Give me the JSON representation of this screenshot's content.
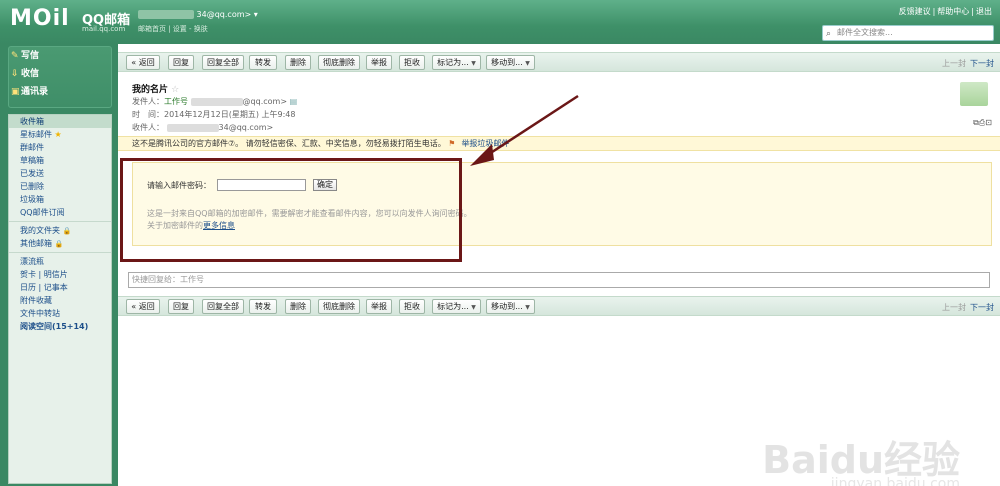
{
  "header": {
    "logo_text": "MOil",
    "brand": "QQ邮箱",
    "brand_url": "mail.qq.com",
    "user_email": "34@qq.com>",
    "user_links": "邮箱首页 | 设置 - 换肤",
    "top_links": [
      "反馈建议",
      "帮助中心",
      "退出"
    ],
    "search_placeholder": "邮件全文搜索..."
  },
  "sidebar": {
    "quick": [
      {
        "label": "写信",
        "icon": "pen-icon"
      },
      {
        "label": "收信",
        "icon": "inbox-icon"
      },
      {
        "label": "通讯录",
        "icon": "contacts-icon"
      }
    ],
    "folders": [
      "收件箱",
      "星标邮件",
      "群邮件",
      "草稿箱",
      "已发送",
      "已删除",
      "垃圾箱",
      "QQ邮件订阅"
    ],
    "folders2": [
      "我的文件夹",
      "其他邮箱"
    ],
    "tools": [
      "漂流瓶",
      "贺卡 | 明信片",
      "日历 | 记事本",
      "附件收藏",
      "文件中转站",
      "阅读空间(15+14)"
    ]
  },
  "toolbar": {
    "buttons": [
      "« 返回",
      "回复",
      "回复全部",
      "转发",
      "删除",
      "彻底删除",
      "举报",
      "拒收",
      "标记为...",
      "移动到..."
    ],
    "prev": "上一封",
    "next": "下一封"
  },
  "mail": {
    "subject": "我的名片",
    "from_label": "发件人：",
    "from_name": "工作号",
    "from_email": "@qq.com>",
    "time_label": "时　间：",
    "time_value": "2014年12月12日(星期五) 上午9:48",
    "to_label": "收件人：",
    "to_email": "34@qq.com>"
  },
  "warning": {
    "text": "这不是腾讯公司的官方邮件⑦。 请勿轻信密保、汇款、中奖信息，勿轻易拨打陌生电话。",
    "report": "举报垃圾邮件"
  },
  "password": {
    "label": "请输入邮件密码：",
    "ok": "确定",
    "note": "这是一封来自QQ邮箱的加密邮件，需要解密才能查看邮件内容，您可以向发件人询问密码。",
    "note2": "关于加密邮件的",
    "more": "更多信息"
  },
  "reply": {
    "placeholder": "快捷回复给：工作号"
  },
  "watermark": {
    "text": "Baidu经验",
    "url": "jingyan.baidu.com"
  }
}
